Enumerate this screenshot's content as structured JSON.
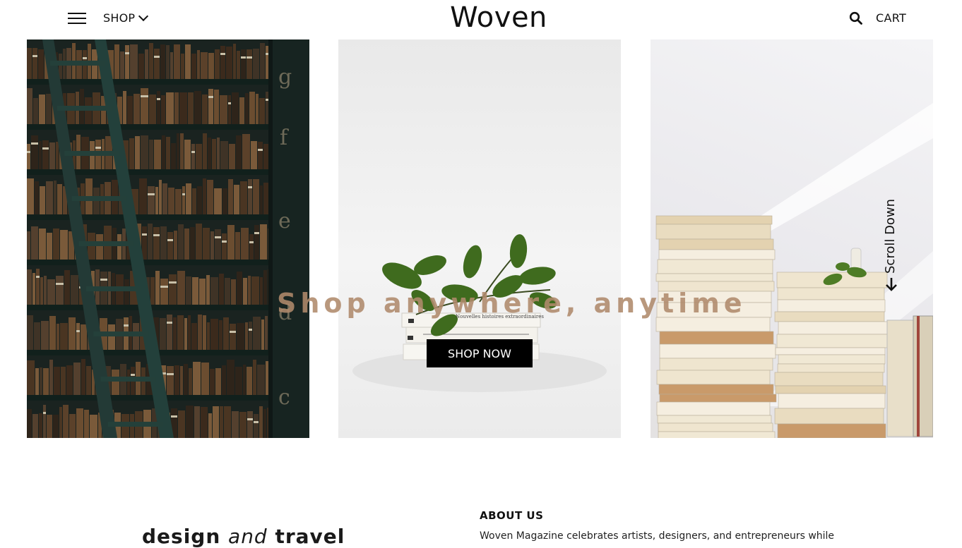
{
  "header": {
    "menu_icon": "hamburger-icon",
    "shop_label": "SHOP",
    "shop_chevron_icon": "chevron-down-icon",
    "logo": "Woven",
    "search_icon": "search-icon",
    "cart_label": "CART"
  },
  "hero": {
    "title": "Shop anywhere, anytime",
    "button_label": "SHOP NOW",
    "scroll_label": "Scroll Down",
    "scroll_icon": "arrow-down-icon",
    "panels": [
      {
        "name": "library-bookshelf-image",
        "spine_letters": [
          "g",
          "f",
          "e",
          "d",
          "c"
        ]
      },
      {
        "name": "books-with-plant-image",
        "book_labels": [
          "Nouvelles histoires extraordinaires"
        ]
      },
      {
        "name": "stacked-books-image"
      }
    ]
  },
  "about": {
    "tagline_part1": "design",
    "tagline_part2": "and",
    "tagline_part3": "travel",
    "heading": "ABOUT US",
    "text": "Woven Magazine celebrates artists, designers, and entrepreneurs while"
  },
  "colors": {
    "hero_title": "#b08a6c",
    "button_bg": "#000000",
    "button_text": "#ffffff"
  }
}
